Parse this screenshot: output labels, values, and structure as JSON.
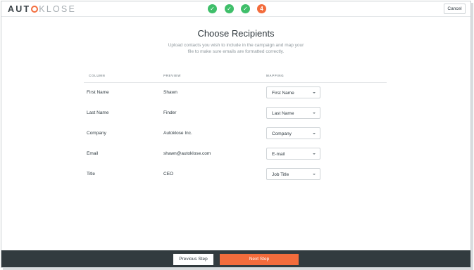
{
  "brand": {
    "logo_prefix": "AUT",
    "logo_suffix": "KLOSE",
    "accent": "#f36c3c"
  },
  "steps": [
    {
      "label": "✓",
      "status": "done"
    },
    {
      "label": "✓",
      "status": "done"
    },
    {
      "label": "✓",
      "status": "done"
    },
    {
      "label": "4",
      "status": "current"
    }
  ],
  "header": {
    "cancel_label": "Cancel"
  },
  "main": {
    "title": "Choose Recipients",
    "subtitle": "Upload contacts you wish to include in the campaign and map your file to make sure emails are formatted correctly."
  },
  "table": {
    "columns": [
      "COLUMN",
      "PREVIEW",
      "MAPPING"
    ],
    "rows": [
      {
        "column": "First Name",
        "preview": "Shawn",
        "mapping": "First Name"
      },
      {
        "column": "Last Name",
        "preview": "Finder",
        "mapping": "Last Name"
      },
      {
        "column": "Company",
        "preview": "Autoklose Inc.",
        "mapping": "Company"
      },
      {
        "column": "Email",
        "preview": "shawn@autoklose.com",
        "mapping": "E-mail"
      },
      {
        "column": "Title",
        "preview": "CEO",
        "mapping": "Job Title"
      }
    ]
  },
  "footer": {
    "prev_label": "Previous Step",
    "next_label": "Next Step"
  }
}
